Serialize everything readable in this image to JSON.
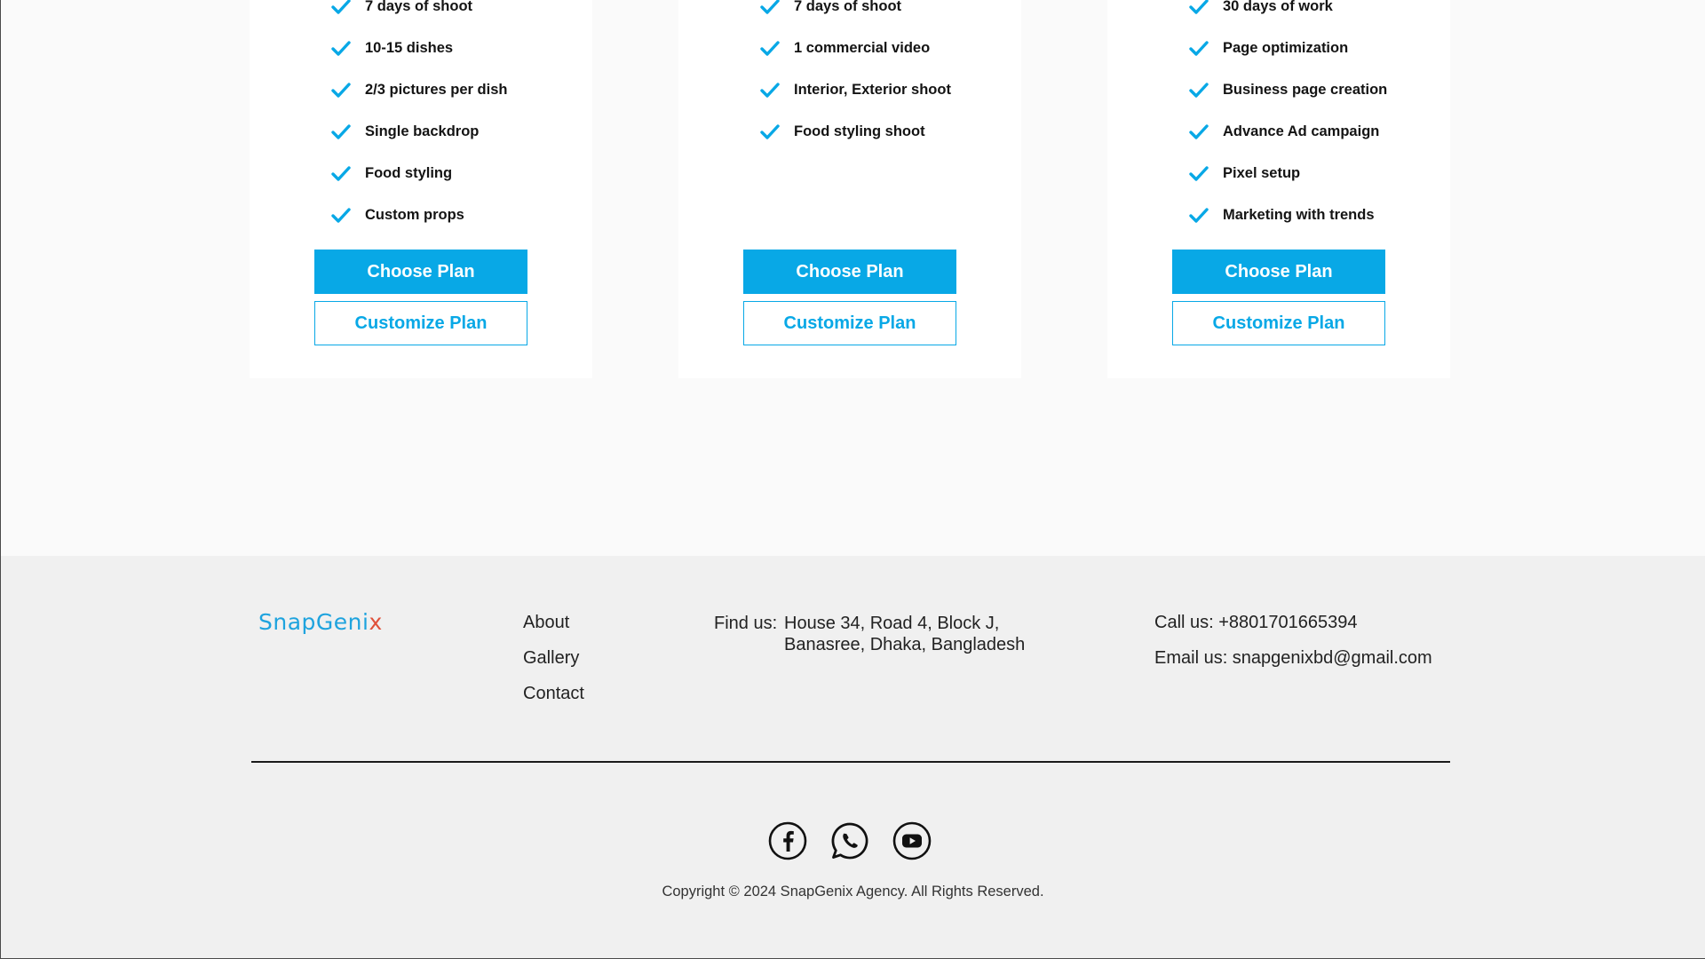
{
  "colors": {
    "accent": "#08a8e6",
    "logo_blue": "#1ea3de",
    "logo_x": "#e0513a",
    "footer_bg": "#f0f0f0"
  },
  "plans": [
    {
      "features": [
        "7 days of shoot",
        "10-15 dishes",
        "2/3 pictures per dish",
        "Single backdrop",
        "Food styling",
        "Custom props"
      ],
      "choose_label": "Choose Plan",
      "customize_label": "Customize Plan"
    },
    {
      "features": [
        "7 days of shoot",
        "1 commercial video",
        "Interior, Exterior shoot",
        "Food styling shoot"
      ],
      "choose_label": "Choose Plan",
      "customize_label": "Customize Plan"
    },
    {
      "features": [
        "30 days of work",
        "Page optimization",
        "Business page creation",
        "Advance Ad campaign",
        "Pixel setup",
        "Marketing with trends"
      ],
      "choose_label": "Choose Plan",
      "customize_label": "Customize Plan"
    }
  ],
  "footer": {
    "logo_main": "SnapGeni",
    "logo_x": "x",
    "nav": [
      "About",
      "Gallery",
      "Contact"
    ],
    "address_label": "Find us:",
    "address_line1": "House 34, Road 4, Block J,",
    "address_line2": "Banasree, Dhaka, Bangladesh",
    "phone": "Call us: +8801701665394",
    "email": "Email us: snapgenixbd@gmail.com",
    "social_icons": [
      "facebook-icon",
      "whatsapp-icon",
      "youtube-icon"
    ],
    "copyright": "Copyright © 2024 SnapGenix Agency. All Rights Reserved."
  }
}
